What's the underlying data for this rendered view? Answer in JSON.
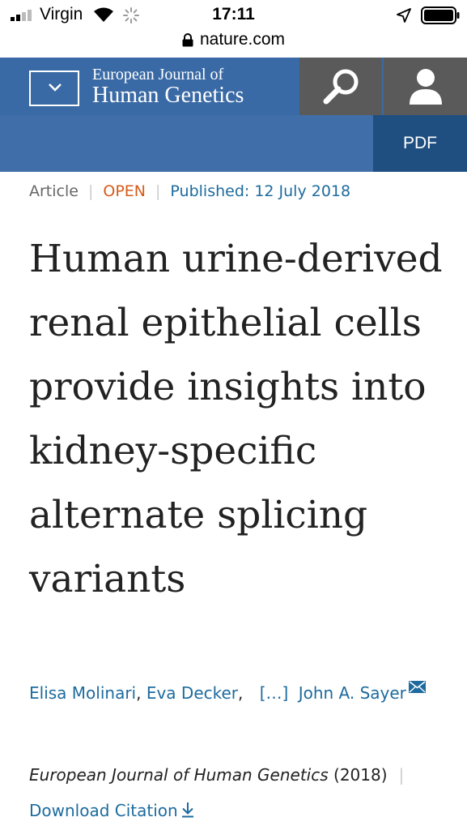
{
  "status_bar": {
    "carrier": "Virgin",
    "time": "17:11"
  },
  "url_bar": {
    "domain": "nature.com"
  },
  "header": {
    "journal_line1": "European Journal of",
    "journal_line2": "Human Genetics",
    "pdf_label": "PDF",
    "background_color": "#3f6ea8",
    "pdf_color": "#1f4f80"
  },
  "article": {
    "type": "Article",
    "access": "OPEN",
    "published": "Published: 12 July 2018",
    "title": "Human urine-derived renal epithelial cells provide insights into kidney-specific alternate splicing variants",
    "authors": {
      "first": "Elisa Molinari",
      "second": "Eva Decker",
      "ellipsis": "[…]",
      "last": "John A. Sayer"
    },
    "citation": {
      "journal": "European Journal of Human Genetics",
      "year": "(2018)"
    },
    "download_label": "Download Citation"
  },
  "icons": {
    "menu": "chevron-down-icon",
    "search": "search-icon",
    "user": "user-icon",
    "mail": "mail-icon",
    "download": "download-icon",
    "lock": "lock-icon"
  }
}
